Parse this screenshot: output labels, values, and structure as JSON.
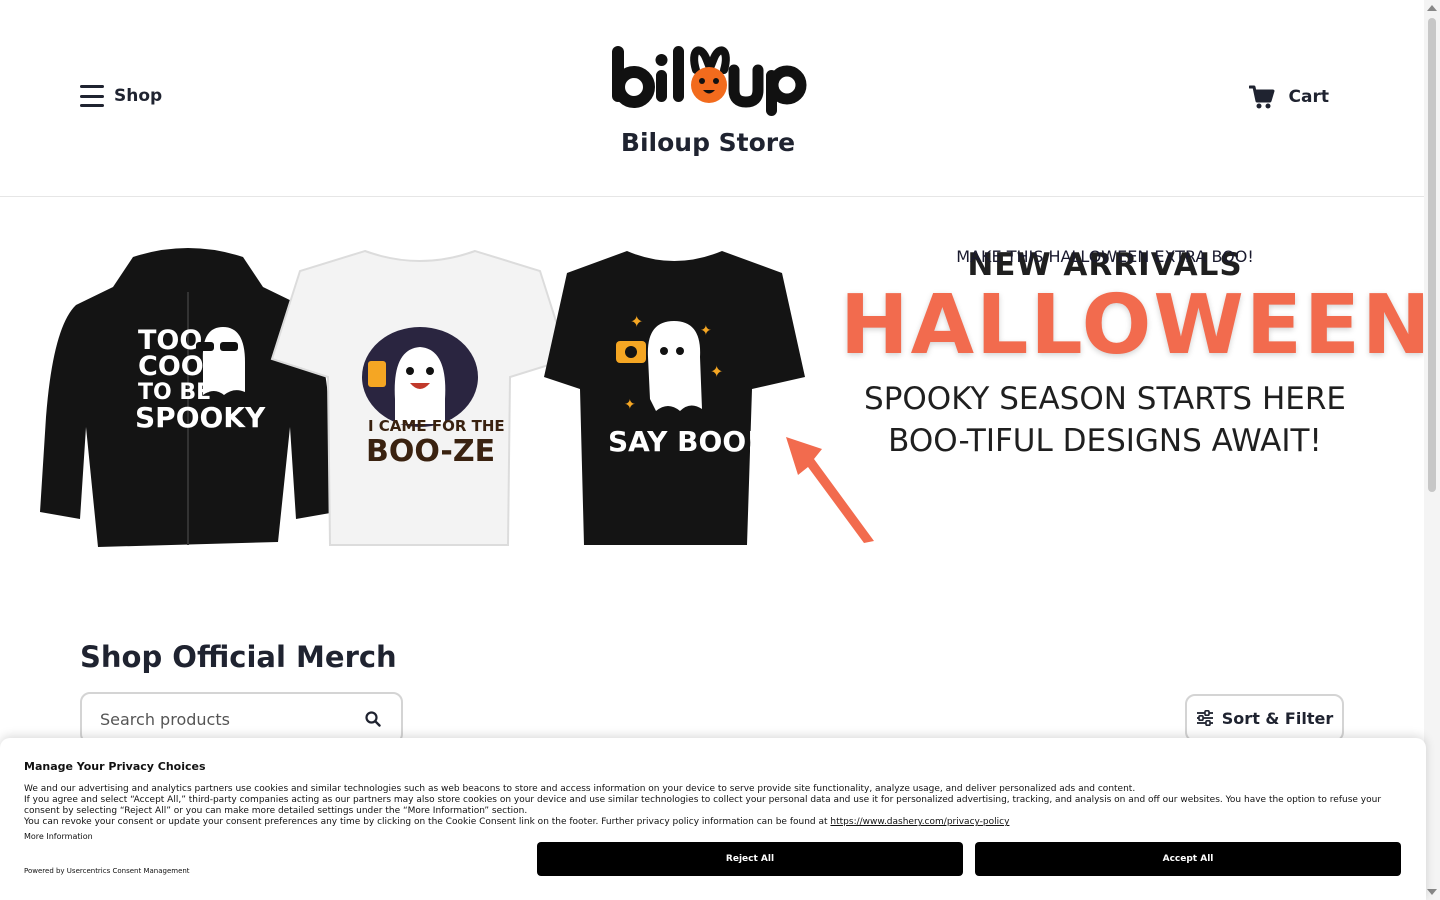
{
  "header": {
    "shop_label": "Shop",
    "cart_label": "Cart",
    "store_name": "Biloup Store",
    "logo_text": "biloup"
  },
  "banner": {
    "new_arrivals": "NEW ARRIVALS",
    "headline": "HALLOWEEN",
    "line1": "SPOOKY SEASON STARTS HERE",
    "line2": "BOO-TIFUL DESIGNS AWAIT!",
    "cta": "MAKE THIS HALLOWEEN EXTRA BOO!",
    "products": [
      {
        "text": "TOO COOL TO BE SPOOKY"
      },
      {
        "text_top": "I CAME FOR THE",
        "text_bottom": "BOO-ZE"
      },
      {
        "text": "SAY BOO!"
      }
    ],
    "accent_color": "#f26b4e"
  },
  "catalog": {
    "title": "Shop Official Merch",
    "search_placeholder": "Search products",
    "sort_filter_label": "Sort & Filter"
  },
  "consent": {
    "title": "Manage Your Privacy Choices",
    "para1": "We and our advertising and analytics partners use cookies and similar technologies such as web beacons to store and access information on your device to serve provide site functionality, analyze usage, and deliver personalized ads and content.",
    "para2": "If you agree and select “Accept All,” third-party companies acting as our partners may also store cookies on your device and use similar technologies to collect your personal data and use it for personalized advertising, tracking, and analysis on and off our websites. You have the option to refuse your consent by selecting “Reject All” or you can make more detailed settings under the “More Information” section.",
    "para3": "You can revoke your consent or update your consent preferences any time by clicking on the Cookie Consent link on the footer. Further privacy policy information can be found at",
    "privacy_link": "https://www.dashery.com/privacy-policy",
    "more_info": "More Information",
    "powered_by": "Powered by Usercentrics Consent Management",
    "reject_label": "Reject All",
    "accept_label": "Accept All"
  }
}
